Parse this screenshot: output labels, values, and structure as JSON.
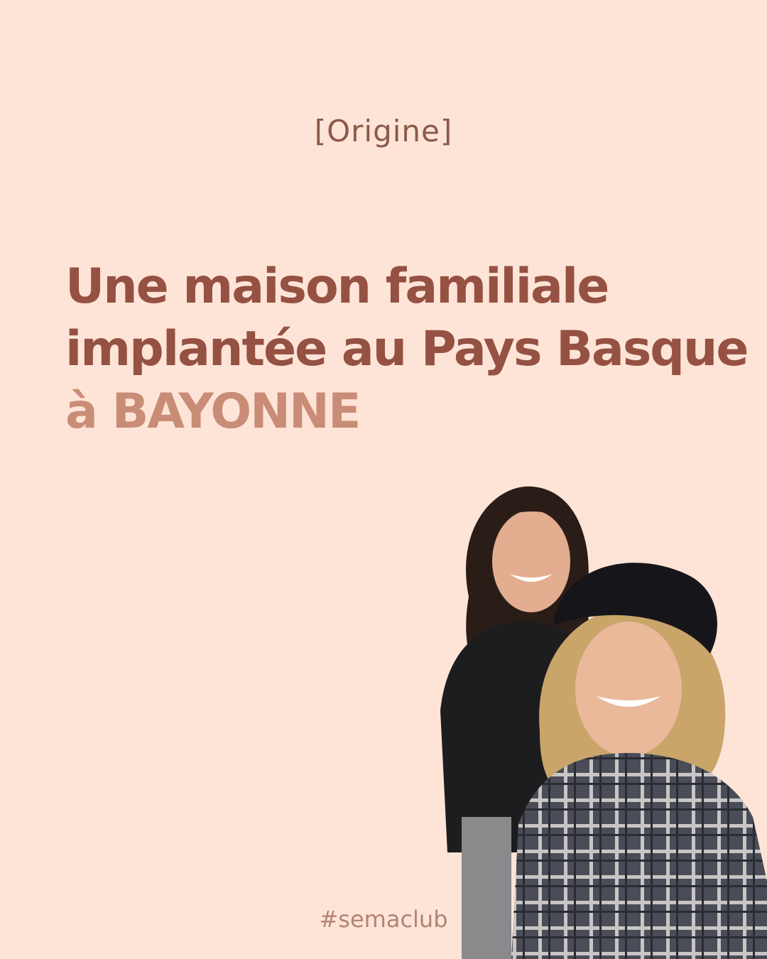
{
  "tag": "[Origine]",
  "headline": {
    "line1": "Une maison familiale",
    "line2": "implantée au Pays Basque",
    "line3_prefix": "à ",
    "line3_city": "BAYONNE"
  },
  "hashtag": "#semaclub",
  "colors": {
    "background": "#fde4d7",
    "headline": "#955142",
    "accent": "#c98c76",
    "tag": "#8c5a48"
  }
}
